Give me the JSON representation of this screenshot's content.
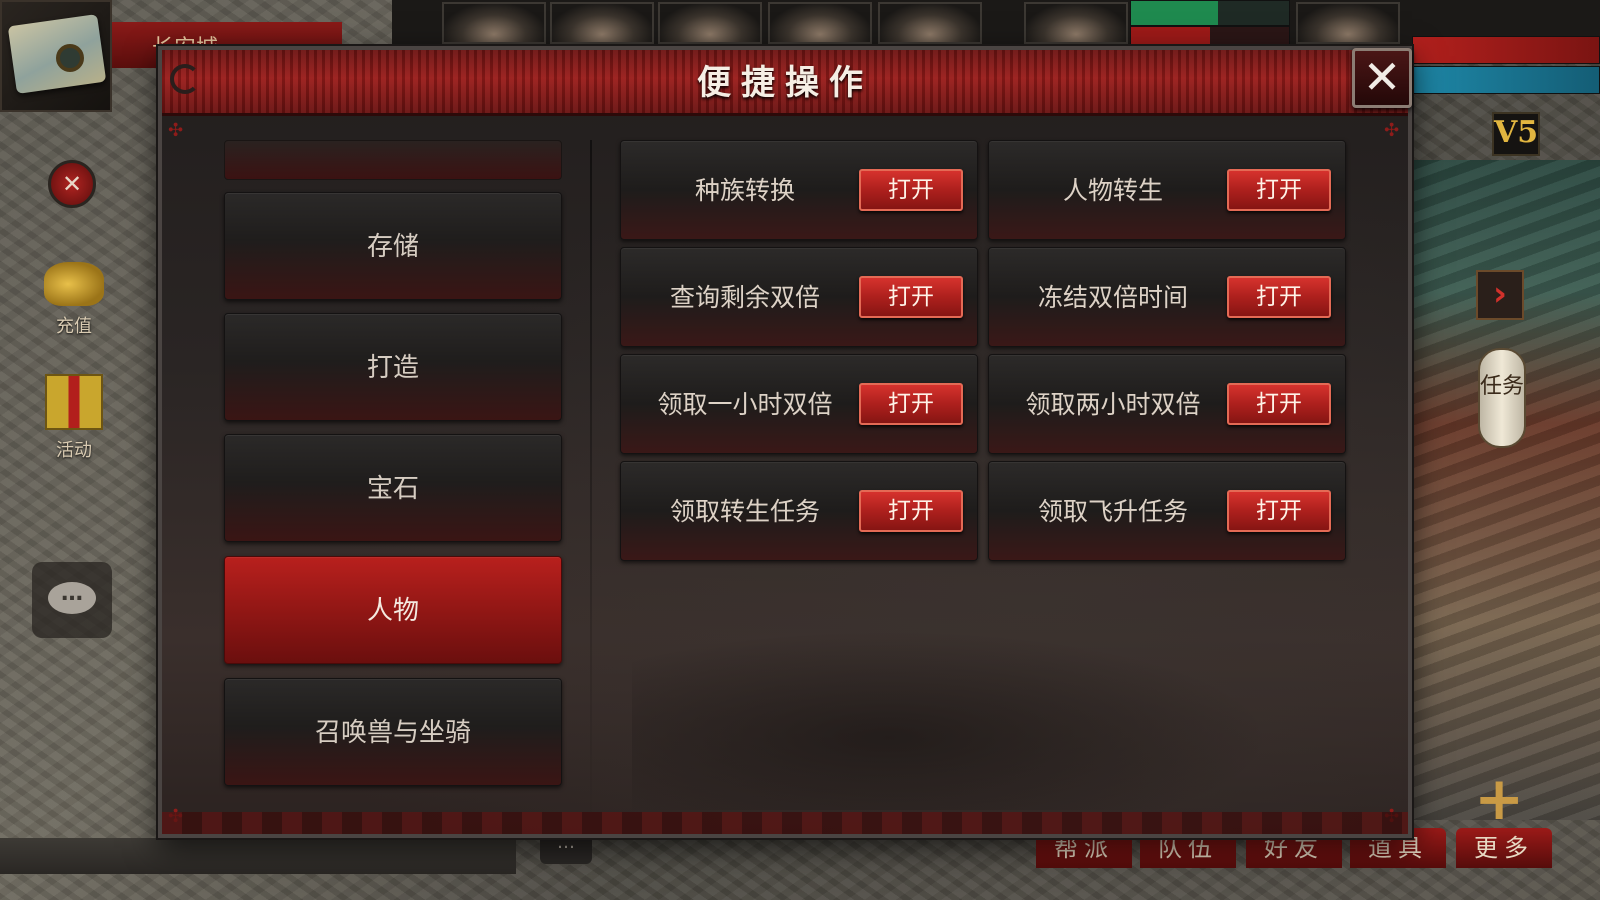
{
  "hud": {
    "city_name": "长安城",
    "vip_label": "V5",
    "recharge_label": "充值",
    "activity_label": "活动",
    "quest_label": "任务",
    "chat_dots": "…",
    "collapse_dots": "…",
    "plus_symbol": "+",
    "bottom_menu": [
      "帮派",
      "队伍",
      "好友",
      "道具",
      "更多"
    ]
  },
  "dialog": {
    "title": "便捷操作",
    "close_symbol": "✕",
    "categories": [
      {
        "label": "存储",
        "active": false
      },
      {
        "label": "打造",
        "active": false
      },
      {
        "label": "宝石",
        "active": false
      },
      {
        "label": "人物",
        "active": true
      },
      {
        "label": "召唤兽与坐骑",
        "active": false
      }
    ],
    "actions": [
      {
        "label": "种族转换",
        "button": "打开"
      },
      {
        "label": "人物转生",
        "button": "打开"
      },
      {
        "label": "查询剩余双倍",
        "button": "打开"
      },
      {
        "label": "冻结双倍时间",
        "button": "打开"
      },
      {
        "label": "领取一小时双倍",
        "button": "打开"
      },
      {
        "label": "领取两小时双倍",
        "button": "打开"
      },
      {
        "label": "领取转生任务",
        "button": "打开"
      },
      {
        "label": "领取飞升任务",
        "button": "打开"
      }
    ]
  },
  "colors": {
    "accent_red": "#b8201d",
    "button_red": "#ad201d",
    "panel_dark": "#221e1d",
    "text_light": "#ddd2c6"
  }
}
